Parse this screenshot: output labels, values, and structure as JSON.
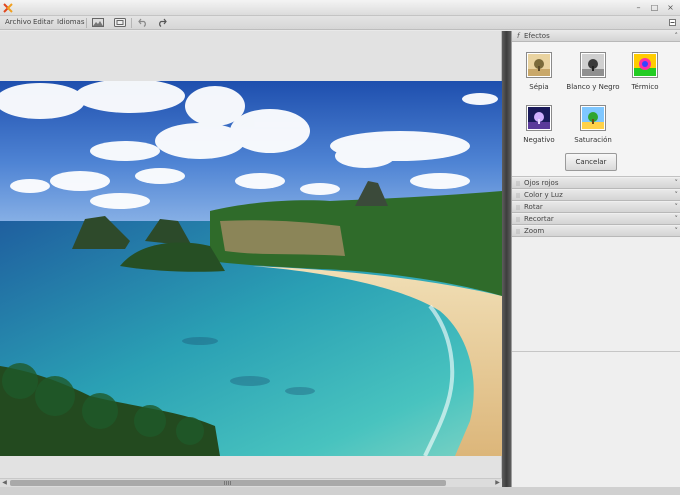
{
  "menu": {
    "items": [
      "Archivo",
      "Editar",
      "Idiomas"
    ]
  },
  "toolbar": {
    "tools": [
      "image-icon",
      "compare-icon",
      "undo-icon",
      "redo-icon"
    ]
  },
  "panel": {
    "effects_title": "Efectos",
    "effects": [
      {
        "label": "Sépia",
        "icon": "sepia-thumbnail-icon"
      },
      {
        "label": "Blanco y Negro",
        "icon": "black-white-thumbnail-icon"
      },
      {
        "label": "Térmico",
        "icon": "thermal-thumbnail-icon"
      },
      {
        "label": "Negativo",
        "icon": "negative-thumbnail-icon"
      },
      {
        "label": "Saturación",
        "icon": "saturation-thumbnail-icon"
      }
    ],
    "cancel_label": "Cancelar",
    "sections": [
      "Ojos rojos",
      "Color y Luz",
      "Rotar",
      "Recortar",
      "Zoom"
    ]
  },
  "colors": {
    "divider": "#4a4a4a",
    "sky": "#3a6fc4",
    "sea": "#2a9fb0",
    "sand": "#e6cfa0"
  }
}
